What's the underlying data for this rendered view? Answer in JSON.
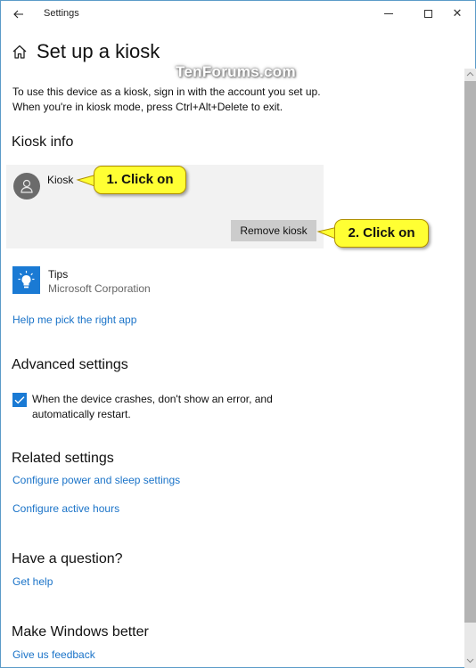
{
  "window": {
    "title": "Settings",
    "back_icon": "arrow-left-icon",
    "controls": {
      "minimize": "minimize-icon",
      "maximize": "maximize-icon",
      "close_glyph": "✕"
    }
  },
  "page": {
    "title": "Set up a kiosk",
    "title_icon": "home-icon",
    "description_line1": "To use this device as a kiosk, sign in with the account you set up.",
    "description_line2": "When you're in kiosk mode, press Ctrl+Alt+Delete to exit."
  },
  "watermark": "TenForums.com",
  "kiosk_info": {
    "heading": "Kiosk info",
    "account_name": "Kiosk",
    "remove_button": "Remove kiosk",
    "app": {
      "name": "Tips",
      "publisher": "Microsoft Corporation",
      "icon": "lightbulb-icon"
    },
    "help_link": "Help me pick the right app"
  },
  "callouts": {
    "step1": "1. Click on",
    "step2": "2. Click on",
    "color": "#ffff33"
  },
  "advanced": {
    "heading": "Advanced settings",
    "checkbox_label": "When the device crashes, don't show an error, and automatically restart.",
    "checkbox_checked": true
  },
  "related": {
    "heading": "Related settings",
    "links": [
      "Configure power and sleep settings",
      "Configure active hours"
    ]
  },
  "question": {
    "heading": "Have a question?",
    "link": "Get help"
  },
  "feedback": {
    "heading": "Make Windows better",
    "link": "Give us feedback"
  },
  "colors": {
    "accent": "#1a7ad4",
    "link": "#1a73c8",
    "card_bg": "#f2f2f2"
  }
}
